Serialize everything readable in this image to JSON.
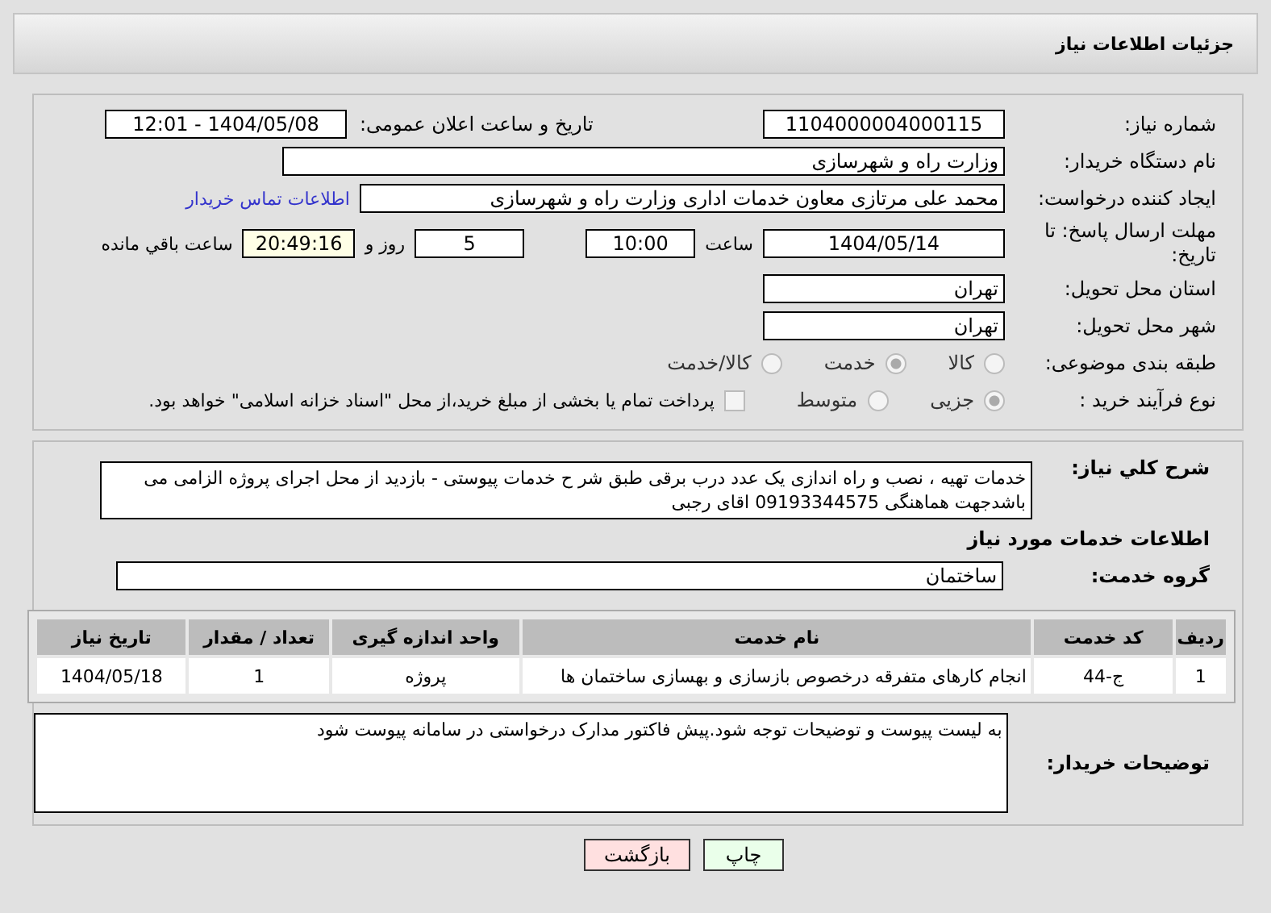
{
  "header": {
    "title": "جزئیات اطلاعات نیاز"
  },
  "need_number": {
    "label": "شماره نیاز:",
    "value": "1104000004000115"
  },
  "announce": {
    "label": "تاریخ و ساعت اعلان عمومی:",
    "value": "1404/05/08 - 12:01"
  },
  "buyer_org": {
    "label": "نام دستگاه خریدار:",
    "value": "وزارت راه و شهرسازی"
  },
  "creator": {
    "label": "ایجاد کننده درخواست:",
    "value": "محمد علی  مرتازی معاون خدمات اداری وزارت راه و شهرسازی",
    "link": "اطلاعات تماس خریدار"
  },
  "deadline": {
    "label": "مهلت ارسال پاسخ: تا تاریخ:",
    "date": "1404/05/14",
    "time_label": "ساعت",
    "time": "10:00",
    "days": "5",
    "days_label": "روز و",
    "remaining": "20:49:16",
    "remaining_label": "ساعت باقي مانده"
  },
  "province": {
    "label": "استان محل تحویل:",
    "value": "تهران"
  },
  "city": {
    "label": "شهر محل تحویل:",
    "value": "تهران"
  },
  "category": {
    "label": "طبقه بندی موضوعی:",
    "options": [
      {
        "label": "كالا",
        "selected": false
      },
      {
        "label": "خدمت",
        "selected": true
      },
      {
        "label": "كالا/خدمت",
        "selected": false
      }
    ]
  },
  "process": {
    "label": "نوع فرآیند خرید :",
    "options": [
      {
        "label": "جزیی",
        "selected": true
      },
      {
        "label": "متوسط",
        "selected": false
      }
    ],
    "payment": {
      "checked": false,
      "text": "پرداخت تمام یا بخشی از مبلغ خرید،از محل \"اسناد خزانه اسلامی\" خواهد بود."
    }
  },
  "description": {
    "label": "شرح کلي نياز:",
    "value": "خدمات تهیه ، نصب و راه اندازی یک عدد درب برقی طبق شر ح خدمات پیوستی - بازدید از محل اجرای پروژه الزامی  می باشدجهت هماهنگی 09193344575 اقای رجبی"
  },
  "services_heading": "اطلاعات خدمات مورد نیاز",
  "service_group": {
    "label": "گروه خدمت:",
    "value": "ساختمان"
  },
  "table": {
    "columns": [
      "ردیف",
      "کد خدمت",
      "نام خدمت",
      "واحد اندازه گیری",
      "تعداد / مقدار",
      "تاریخ نیاز"
    ],
    "rows": [
      [
        "1",
        "ج-44",
        "انجام کارهای متفرقه درخصوص بازسازی و بهسازی ساختمان ها",
        "پروژه",
        "1",
        "1404/05/18"
      ]
    ]
  },
  "buyer_notes": {
    "label": "توضیحات خریدار:",
    "value": "به لیست پیوست و توضیحات توجه شود.پیش فاکتور مدارک درخواستی در سامانه پیوست شود"
  },
  "buttons": [
    {
      "label": "چاپ",
      "kind": "print"
    },
    {
      "label": "بازگشت",
      "kind": "back"
    }
  ]
}
